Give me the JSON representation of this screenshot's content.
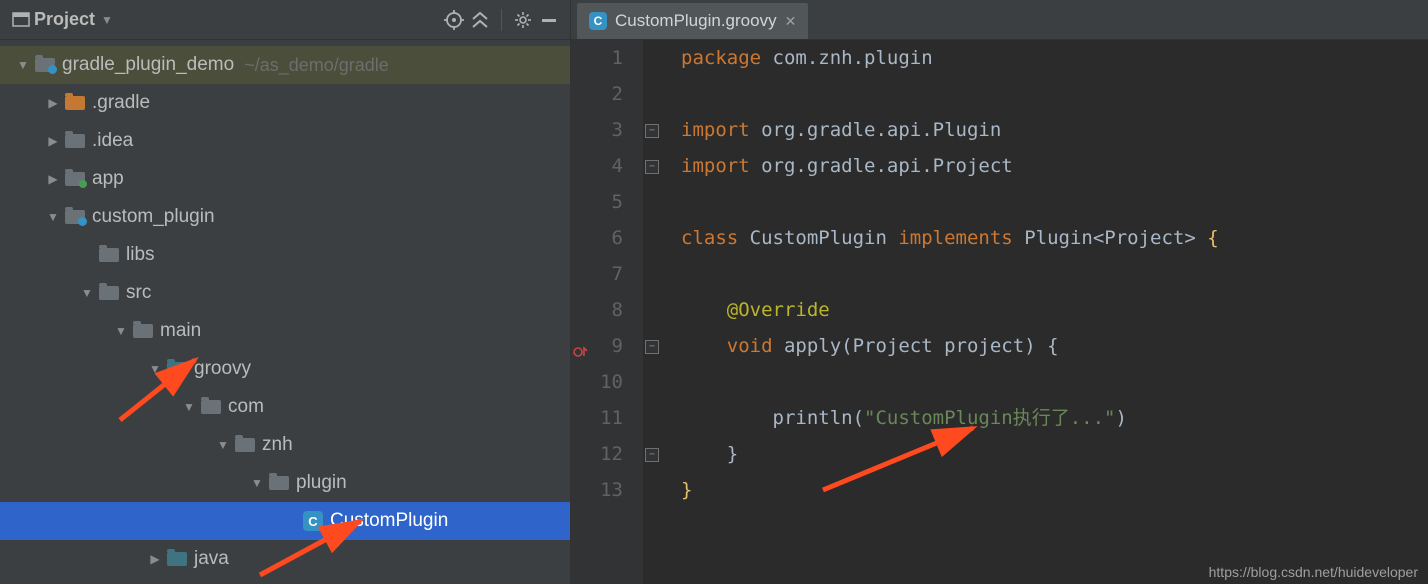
{
  "sidebar": {
    "title": "Project",
    "tree": {
      "root": {
        "name": "gradle_plugin_demo",
        "pathHint": "~/as_demo/gradle"
      },
      "gradle": ".gradle",
      "idea": ".idea",
      "app": "app",
      "custom_plugin": "custom_plugin",
      "libs": "libs",
      "src": "src",
      "main": "main",
      "groovy": "groovy",
      "com": "com",
      "znh": "znh",
      "plugin": "plugin",
      "customPlugin": "CustomPlugin",
      "java": "java"
    }
  },
  "tab": {
    "label": "CustomPlugin.groovy",
    "iconLetter": "C"
  },
  "gutter": [
    "1",
    "2",
    "3",
    "4",
    "5",
    "6",
    "7",
    "8",
    "9",
    "10",
    "11",
    "12",
    "13"
  ],
  "code": {
    "l1": {
      "kw": "package",
      "rest": " com.znh.plugin"
    },
    "l3": {
      "kw": "import",
      "rest": " org.gradle.api.Plugin"
    },
    "l4": {
      "kw": "import",
      "rest": " org.gradle.api.Project"
    },
    "l6": {
      "kw1": "class",
      "name": " CustomPlugin ",
      "kw2": "implements",
      "rest": " Plugin<Project> "
    },
    "l8": {
      "ann": "@Override"
    },
    "l9": {
      "kw": "void",
      "rest": " apply(Project project) {"
    },
    "l11": {
      "pre": "        println(",
      "str": "\"CustomPlugin执行了...\"",
      "post": ")"
    },
    "l12": "    }",
    "l13": "}"
  },
  "watermark": "https://blog.csdn.net/huideveloper"
}
